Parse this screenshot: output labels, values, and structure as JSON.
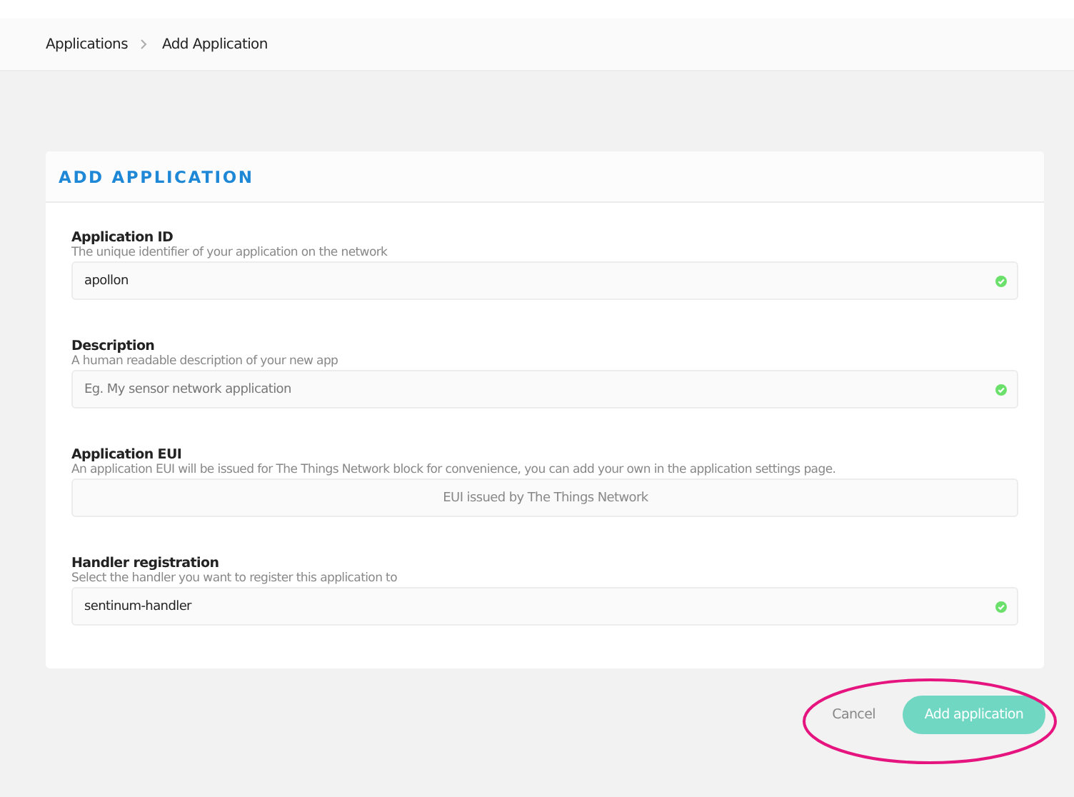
{
  "breadcrumb": [
    {
      "label": "Applications"
    },
    {
      "label": "Add Application"
    }
  ],
  "card": {
    "title": "ADD APPLICATION"
  },
  "fields": [
    {
      "label": "Application ID",
      "hint": "The unique identifier of your application on the network",
      "value": "apollon",
      "valid": true,
      "disabled": false
    },
    {
      "label": "Description",
      "hint": "A human readable description of your new app",
      "placeholder": "Eg. My sensor network application",
      "valid": true,
      "disabled": false
    },
    {
      "label": "Application EUI",
      "hint": "An application EUI will be issued for The Things Network block for convenience, you can add your own in the application settings page.",
      "placeholder": "EUI issued by The Things Network",
      "valid": false,
      "disabled": true
    },
    {
      "label": "Handler registration",
      "hint": "Select the handler you want to register this application to",
      "value": "sentinum-handler",
      "valid": true,
      "disabled": false
    }
  ],
  "actions": {
    "cancel": "Cancel",
    "submit": "Add application",
    "highlighted": true
  }
}
